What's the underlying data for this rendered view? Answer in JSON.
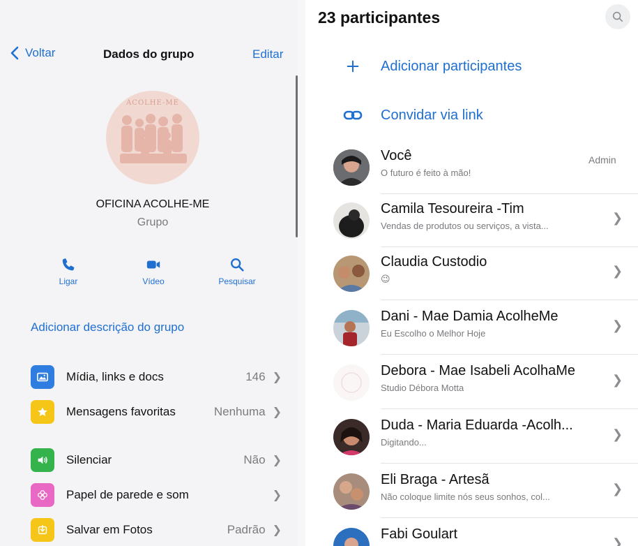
{
  "left_panel": {
    "nav": {
      "back_label": "Voltar",
      "title": "Dados do grupo",
      "edit_label": "Editar"
    },
    "group": {
      "logo_text": "ACOLHE-ME",
      "name": "OFICINA ACOLHE-ME",
      "type": "Grupo"
    },
    "actions": [
      {
        "label": "Ligar",
        "icon": "phone-icon"
      },
      {
        "label": "Vídeo",
        "icon": "video-icon"
      },
      {
        "label": "Pesquisar",
        "icon": "search-icon"
      }
    ],
    "add_description": "Adicionar descrição do grupo",
    "settings": [
      {
        "label": "Mídia, links e docs",
        "value": "146",
        "icon": "photo-icon",
        "color": "#2f7de1"
      },
      {
        "label": "Mensagens favoritas",
        "value": "Nenhuma",
        "icon": "star-icon",
        "color": "#f5c518"
      },
      {
        "label": "Silenciar",
        "value": "Não",
        "icon": "speaker-icon",
        "color": "#34b24c"
      },
      {
        "label": "Papel de parede e som",
        "value": "",
        "icon": "flower-icon",
        "color": "#e868c4"
      },
      {
        "label": "Salvar em Fotos",
        "value": "Padrão",
        "icon": "download-icon",
        "color": "#f5c518"
      }
    ]
  },
  "right_panel": {
    "title": "23 participantes",
    "search_icon": "search-icon",
    "actions": [
      {
        "label": "Adicionar participantes",
        "icon": "plus-icon"
      },
      {
        "label": "Convidar via link",
        "icon": "link-icon"
      }
    ],
    "members": [
      {
        "name": "Você",
        "status": "O futuro é feito à mão!",
        "badge": "Admin"
      },
      {
        "name": "Camila Tesoureira -Tim",
        "status": "Vendas de produtos ou serviços, a vista...",
        "badge": ""
      },
      {
        "name": "Claudia Custodio",
        "status": "😉",
        "badge": ""
      },
      {
        "name": "Dani - Mae Damia AcolheMe",
        "status": "Eu Escolho o Melhor Hoje",
        "badge": ""
      },
      {
        "name": "Debora - Mae Isabeli AcolhaMe",
        "status": "Studio Débora Motta",
        "badge": ""
      },
      {
        "name": "Duda - Maria Eduarda -Acolh...",
        "status": "Digitando...",
        "badge": ""
      },
      {
        "name": "Eli  Braga - Artesã",
        "status": "Não coloque limite nós seus sonhos, col...",
        "badge": ""
      },
      {
        "name": "Fabi Goulart",
        "status": "",
        "badge": ""
      }
    ],
    "colors": {
      "accent": "#1f6fd1"
    }
  }
}
